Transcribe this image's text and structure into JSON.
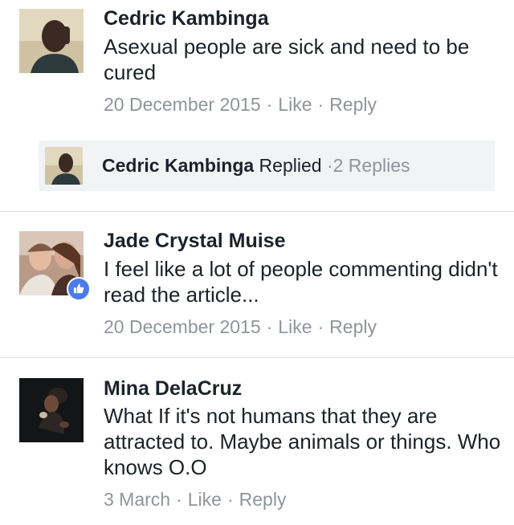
{
  "comments": [
    {
      "author": "Cedric Kambinga",
      "text": "Asexual people are sick and need to be cured",
      "date": "20 December 2015",
      "like_label": "Like",
      "reply_label": "Reply",
      "replies": {
        "author": "Cedric Kambinga",
        "action": "Replied",
        "count_label": "2 Replies"
      }
    },
    {
      "author": "Jade Crystal Muise",
      "text": "I feel like a lot of people commenting didn't read the article...",
      "date": "20 December 2015",
      "like_label": "Like",
      "reply_label": "Reply"
    },
    {
      "author": "Mina DelaCruz",
      "text": "What If it's not humans that they are attracted to. Maybe animals or things. Who knows O.O",
      "date": "3 March",
      "like_label": "Like",
      "reply_label": "Reply"
    }
  ],
  "separator": "·",
  "colors": {
    "meta_text": "#90949c",
    "like_badge": "#4a7bec",
    "reply_background": "#f2f3f5"
  }
}
